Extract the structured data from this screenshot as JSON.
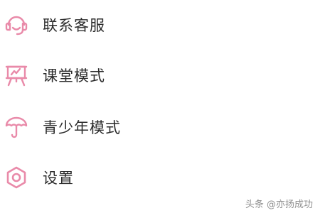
{
  "accent_color": "#e98aa9",
  "menu": {
    "items": [
      {
        "label": "联系客服",
        "icon": "headset-icon"
      },
      {
        "label": "课堂模式",
        "icon": "presentation-board-icon"
      },
      {
        "label": "青少年模式",
        "icon": "umbrella-icon"
      },
      {
        "label": "设置",
        "icon": "hexagon-gear-icon"
      }
    ]
  },
  "watermark": {
    "text": "头条 @亦扬成功"
  }
}
